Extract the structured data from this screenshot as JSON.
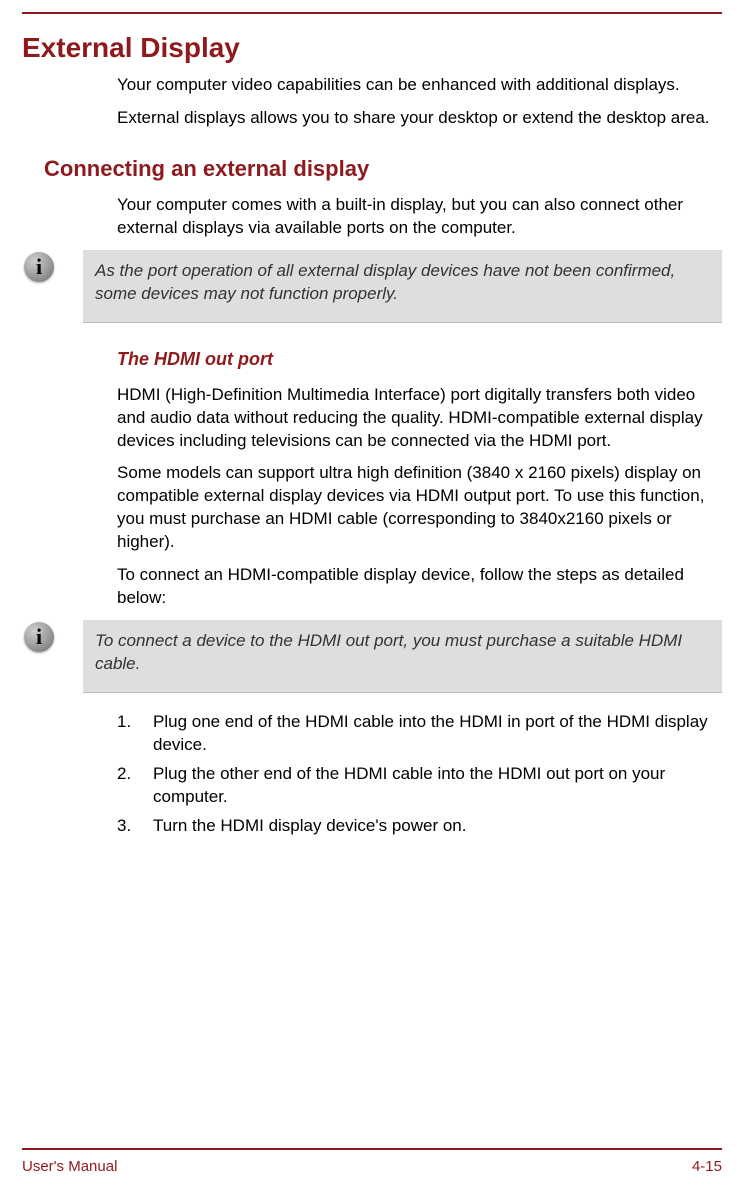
{
  "title": "External Display",
  "intro1": "Your computer video capabilities can be enhanced with additional displays.",
  "intro2": "External displays allows you to share your desktop or extend the desktop area.",
  "section2": {
    "heading": "Connecting an external display",
    "para1": "Your computer comes with a built-in display, but you can also connect other external displays via available ports on the computer.",
    "note1": "As the port operation of all external display devices have not been confirmed, some devices may not function properly.",
    "sub3": "The HDMI out port",
    "hdmi_p1": "HDMI (High-Definition Multimedia Interface) port digitally transfers both video and audio data without reducing the quality. HDMI-compatible external display devices including televisions can be connected via the HDMI port.",
    "hdmi_p2": "Some models can support ultra high definition (3840 x 2160 pixels) display on compatible external display devices via HDMI output port. To use this function, you must purchase an HDMI cable (corresponding to 3840x2160 pixels or higher).",
    "hdmi_p3": "To connect an HDMI-compatible display device, follow the steps as detailed below:",
    "note2": "To connect a device to the HDMI out port, you must purchase a suitable HDMI cable.",
    "steps": [
      "Plug one end of the HDMI cable into the HDMI in port of the HDMI display device.",
      "Plug the other end of the HDMI cable into the HDMI out port on your computer.",
      "Turn the HDMI display device's power on."
    ]
  },
  "footer": {
    "left": "User's Manual",
    "right": "4-15"
  },
  "icon_glyph": "i"
}
